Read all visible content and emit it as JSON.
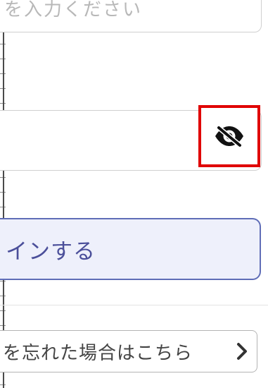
{
  "email_field": {
    "placeholder": "を入力ください"
  },
  "password_field": {
    "visibility_toggle_icon": "eye-slash-icon"
  },
  "login_button": {
    "label": "インする"
  },
  "forgot_password": {
    "label": "を忘れた場合はこちら",
    "icon": "chevron-right-icon"
  },
  "colors": {
    "highlight": "#e00000",
    "login_border": "#5f6db7",
    "login_background": "#eef0fb",
    "login_text": "#4b4f9a"
  }
}
